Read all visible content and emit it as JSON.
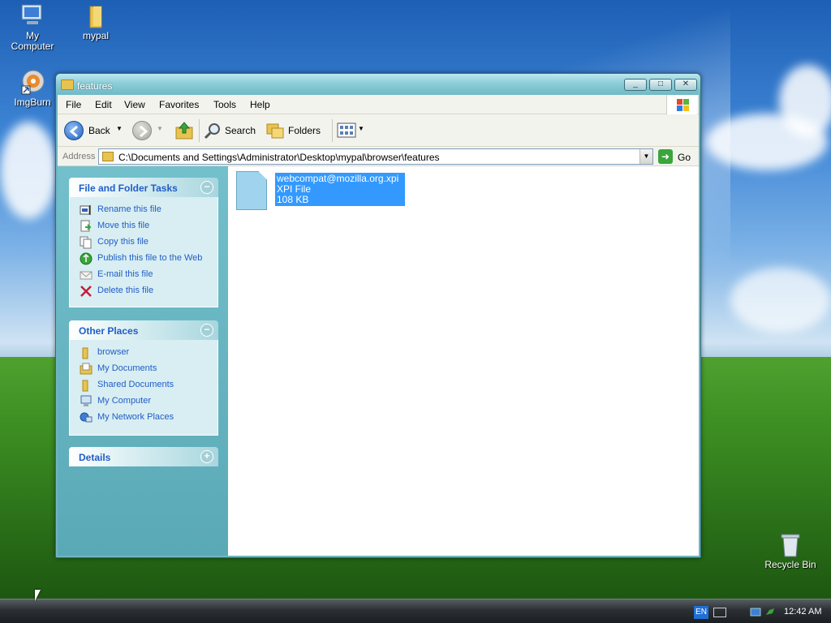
{
  "desktop": {
    "icons": [
      {
        "label": "My\nComputer"
      },
      {
        "label": "mypal"
      },
      {
        "label": "ImgBurn"
      },
      {
        "label": "Recycle Bin"
      }
    ]
  },
  "window": {
    "title": "features",
    "controls": {
      "minimize": "_",
      "maximize": "□",
      "close": "✕"
    }
  },
  "menu": [
    "File",
    "Edit",
    "View",
    "Favorites",
    "Tools",
    "Help"
  ],
  "toolbar": {
    "back_label": "Back",
    "search_label": "Search",
    "folders_label": "Folders"
  },
  "address": {
    "label": "Address",
    "path": "C:\\Documents and Settings\\Administrator\\Desktop\\mypal\\browser\\features",
    "go_label": "Go"
  },
  "file_tasks": {
    "title": "File and Folder Tasks",
    "items": [
      "Rename this file",
      "Move this file",
      "Copy this file",
      "Publish this file to the Web",
      "E-mail this file",
      "Delete this file"
    ]
  },
  "other_places": {
    "title": "Other Places",
    "items": [
      "browser",
      "My Documents",
      "Shared Documents",
      "My Computer",
      "My Network Places"
    ]
  },
  "details": {
    "title": "Details"
  },
  "file": {
    "name": "webcompat@mozilla.org.xpi",
    "type": "XPI File",
    "size": "108 KB"
  },
  "taskbar": {
    "lang": "EN",
    "clock": "12:42 AM"
  },
  "colors": {
    "link_blue": "#215dc6",
    "selection": "#3399ff",
    "folder": "#e9c34f"
  }
}
